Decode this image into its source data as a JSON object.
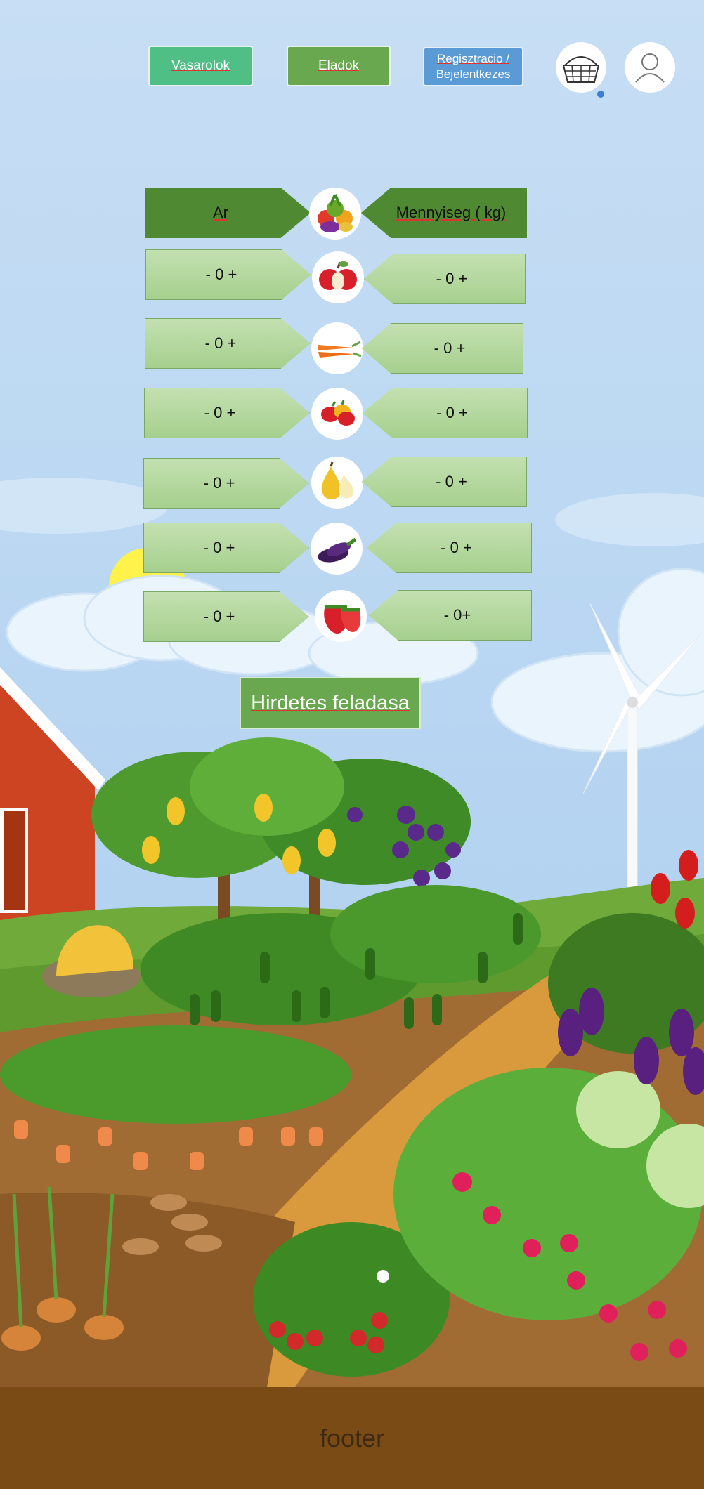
{
  "nav": {
    "buyers_label": "Vasarolok",
    "sellers_label": "Eladok",
    "register_label": "Regisztracio / Bejelentkezes"
  },
  "table": {
    "price_header": "Ar",
    "quantity_header": "Mennyiseg ( kg)",
    "rows": [
      {
        "produce": "apple-icon",
        "price": "- 0 +",
        "quantity": "- 0 +"
      },
      {
        "produce": "carrot-icon",
        "price": "- 0 +",
        "quantity": "- 0 +"
      },
      {
        "produce": "pepper-icon",
        "price": "- 0 +",
        "quantity": "- 0 +"
      },
      {
        "produce": "pear-icon",
        "price": "- 0 +",
        "quantity": "- 0 +"
      },
      {
        "produce": "eggplant-icon",
        "price": "- 0 +",
        "quantity": "- 0 +"
      },
      {
        "produce": "strawberry-icon",
        "price": "- 0 +",
        "quantity": "- 0+"
      }
    ]
  },
  "submit_label": "Hirdetes feladasa",
  "footer_label": "footer",
  "colors": {
    "sky": "#c6def3",
    "buyers": "#4fbf86",
    "sellers": "#6aa84f",
    "register": "#5b9bd5",
    "header_dark": "#4f8a32",
    "cell_light": "#b4d89c",
    "footer": "#7a4b14"
  }
}
